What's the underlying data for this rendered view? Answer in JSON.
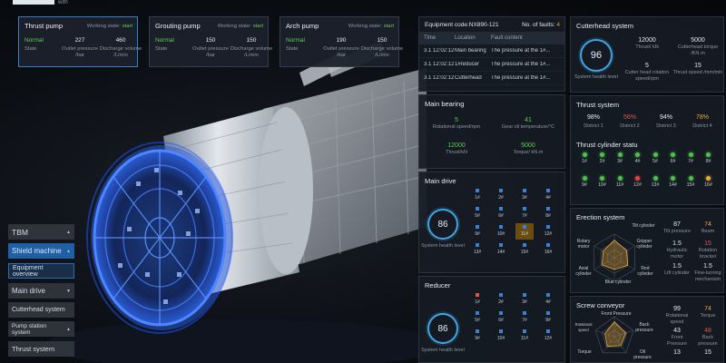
{
  "header": {
    "title_fragment": "with"
  },
  "pumps": [
    {
      "name": "Thrust pump",
      "working_state_label": "Working state:",
      "working_state": "start",
      "state": "Normal",
      "outlet_pressure": "227",
      "discharge_volume": "460",
      "state_label": "State",
      "outlet_label": "Outlet pressure /bar",
      "discharge_label": "Discharge volume /L/min",
      "active": true
    },
    {
      "name": "Grouting pump",
      "working_state_label": "Working state:",
      "working_state": "start",
      "state": "Normal",
      "outlet_pressure": "150",
      "discharge_volume": "150",
      "state_label": "State",
      "outlet_label": "Outlet pressure /bar",
      "discharge_label": "Discharge volume /L/min",
      "active": false
    },
    {
      "name": "Arch pump",
      "working_state_label": "Working state:",
      "working_state": "start",
      "state": "Normal",
      "outlet_pressure": "190",
      "discharge_volume": "150",
      "state_label": "State",
      "outlet_label": "Outlet pressure /bar",
      "discharge_label": "Discharge volume /L/min",
      "active": false
    }
  ],
  "nav": {
    "items": [
      "TBM",
      "Shield machine",
      "Equipment overview",
      "Main drive",
      "Cutterhead system",
      "Pump station system",
      "Thrust system"
    ]
  },
  "equipment": {
    "code_label": "Equipment code:NX890-121",
    "faults_label": "No. of faults:",
    "faults_count": "4",
    "columns": [
      "Time",
      "Location",
      "Fault content"
    ],
    "rows": [
      [
        "3.1 12:02:12",
        "Main bearing",
        "The pressure at the 1#..."
      ],
      [
        "3.1 12:02:12",
        "1#reducer",
        "The pressure at the 1#..."
      ],
      [
        "3.1 12:02:12",
        "Cutterhead",
        "The pressure at the 1#..."
      ]
    ]
  },
  "main_bearing": {
    "title": "Main bearing",
    "items": [
      {
        "value": "5",
        "label": "Rotational speed/rpm",
        "color": "green"
      },
      {
        "value": "41",
        "label": "Gear oil temperature/°C",
        "color": "green"
      },
      {
        "value": "12000",
        "label": "Thrust/kN",
        "color": "green"
      },
      {
        "value": "5000",
        "label": "Torque/ kN.m",
        "color": "green"
      }
    ]
  },
  "main_drive": {
    "title": "Main drive",
    "health": "86",
    "health_label": "System health level",
    "motors": [
      {
        "n": "1#"
      },
      {
        "n": "2#"
      },
      {
        "n": "3#"
      },
      {
        "n": "4#"
      },
      {
        "n": "5#"
      },
      {
        "n": "6#"
      },
      {
        "n": "7#"
      },
      {
        "n": "8#"
      },
      {
        "n": "9#"
      },
      {
        "n": "10#"
      },
      {
        "n": "11#",
        "hl": true
      },
      {
        "n": "12#"
      },
      {
        "n": "13#"
      },
      {
        "n": "14#"
      },
      {
        "n": "15#"
      },
      {
        "n": "16#"
      }
    ]
  },
  "reducer": {
    "title": "Reducer",
    "health": "86",
    "health_label": "System health level",
    "motors": [
      {
        "n": "1#",
        "red": true
      },
      {
        "n": "2#"
      },
      {
        "n": "3#"
      },
      {
        "n": "4#"
      },
      {
        "n": "5#"
      },
      {
        "n": "6#"
      },
      {
        "n": "7#"
      },
      {
        "n": "8#"
      },
      {
        "n": "9#"
      },
      {
        "n": "10#"
      },
      {
        "n": "11#"
      },
      {
        "n": "12#"
      }
    ]
  },
  "cutterhead": {
    "title": "Cutterhead system",
    "health": "96",
    "health_label": "System health level",
    "items": [
      {
        "value": "12000",
        "label": "Thrust/ kN"
      },
      {
        "value": "5000",
        "label": "Cutterhead torque /KN·m"
      },
      {
        "value": "5",
        "label": "Cutter head rotation speed/rpm"
      },
      {
        "value": "15",
        "label": "Thrust speed /mm/min"
      }
    ]
  },
  "thrust_system": {
    "title": "Thrust system",
    "districts": [
      {
        "value": "98%",
        "label": "District 1",
        "color": "white"
      },
      {
        "value": "56%",
        "label": "District 2",
        "color": "red"
      },
      {
        "value": "94%",
        "label": "District 3",
        "color": "white"
      },
      {
        "value": "78%",
        "label": "District 4",
        "color": "orange"
      }
    ],
    "cyl_title": "Thrust cylinder statu",
    "cylinders": [
      {
        "n": "1#",
        "c": "#4cc24a"
      },
      {
        "n": "2#",
        "c": "#4cc24a"
      },
      {
        "n": "3#",
        "c": "#4cc24a"
      },
      {
        "n": "4#",
        "c": "#4cc24a"
      },
      {
        "n": "5#",
        "c": "#4cc24a"
      },
      {
        "n": "6#",
        "c": "#4cc24a"
      },
      {
        "n": "7#",
        "c": "#4cc24a"
      },
      {
        "n": "8#",
        "c": "#4cc24a"
      },
      {
        "n": "9#",
        "c": "#4cc24a"
      },
      {
        "n": "10#",
        "c": "#4cc24a"
      },
      {
        "n": "11#",
        "c": "#4cc24a"
      },
      {
        "n": "12#",
        "c": "#e0463f"
      },
      {
        "n": "13#",
        "c": "#4cc24a"
      },
      {
        "n": "14#",
        "c": "#4cc24a"
      },
      {
        "n": "15#",
        "c": "#4cc24a"
      },
      {
        "n": "16#",
        "c": "#e9a93a"
      }
    ]
  },
  "erection": {
    "title": "Erection system",
    "axes": [
      "Tilt cylinder",
      "Gripper cylinder",
      "Red cylinder",
      "Blue cylinder",
      "Axial cylinder",
      "Rotary motor"
    ],
    "values": [
      0.75,
      0.6,
      0.65,
      0.5,
      0.6,
      0.55
    ],
    "items": [
      {
        "value": "87",
        "label": "Tilt pressure",
        "color": "white"
      },
      {
        "value": "74",
        "label": "Beam",
        "color": "orange"
      },
      {
        "value": "1.5",
        "label": "Hydraulic motor",
        "color": "white"
      },
      {
        "value": "15",
        "label": "Rotation bracket",
        "color": "red"
      },
      {
        "value": "1.5",
        "label": "Lift cylinder",
        "color": "white"
      },
      {
        "value": "1.5",
        "label": "Fine-turning mechanism",
        "color": "white"
      }
    ]
  },
  "screw": {
    "title": "Screw conveyor",
    "axes": [
      "Front Pressure",
      "Back pressure",
      "Oil pressure",
      "Torque",
      "Rotational speed"
    ],
    "values": [
      0.75,
      0.6,
      0.55,
      0.6,
      0.5
    ],
    "items": [
      {
        "value": "99",
        "label": "Rotational speed",
        "color": "white"
      },
      {
        "value": "74",
        "label": "Torque",
        "color": "orange"
      },
      {
        "value": "43",
        "label": "Front Pressure",
        "color": "white"
      },
      {
        "value": "48",
        "label": "Back pressure",
        "color": "red"
      },
      {
        "value": "13",
        "label": "",
        "color": "white"
      },
      {
        "value": "15",
        "label": "",
        "color": "white"
      }
    ]
  },
  "colors": {
    "accent": "#3fa6e6",
    "ok": "#5ed04f",
    "warn": "#e9a93a",
    "bad": "#e0574f"
  }
}
